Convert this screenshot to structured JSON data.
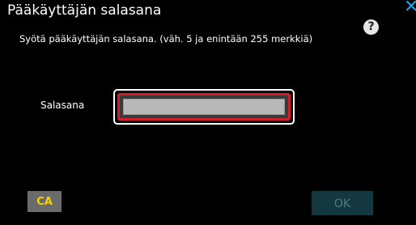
{
  "dialog": {
    "title": "Pääkäyttäjän salasana",
    "instruction": "Syötä pääkäyttäjän salasana. (väh. 5 ja enintään 255 merkkiä)",
    "help_icon": "question-mark-icon",
    "help_label": "?",
    "close_icon": "close-x-icon",
    "close_label": "✕"
  },
  "form": {
    "password_label": "Salasana",
    "password_value": "",
    "password_placeholder": ""
  },
  "buttons": {
    "ca_label": "CA",
    "ok_label": "OK",
    "ok_enabled": false
  },
  "colors": {
    "background": "#000000",
    "focus_border": "#d01c2b",
    "ca_text": "#f5d400",
    "ok_disabled_bg": "#13383f",
    "close_accent": "#1aa3e6"
  }
}
